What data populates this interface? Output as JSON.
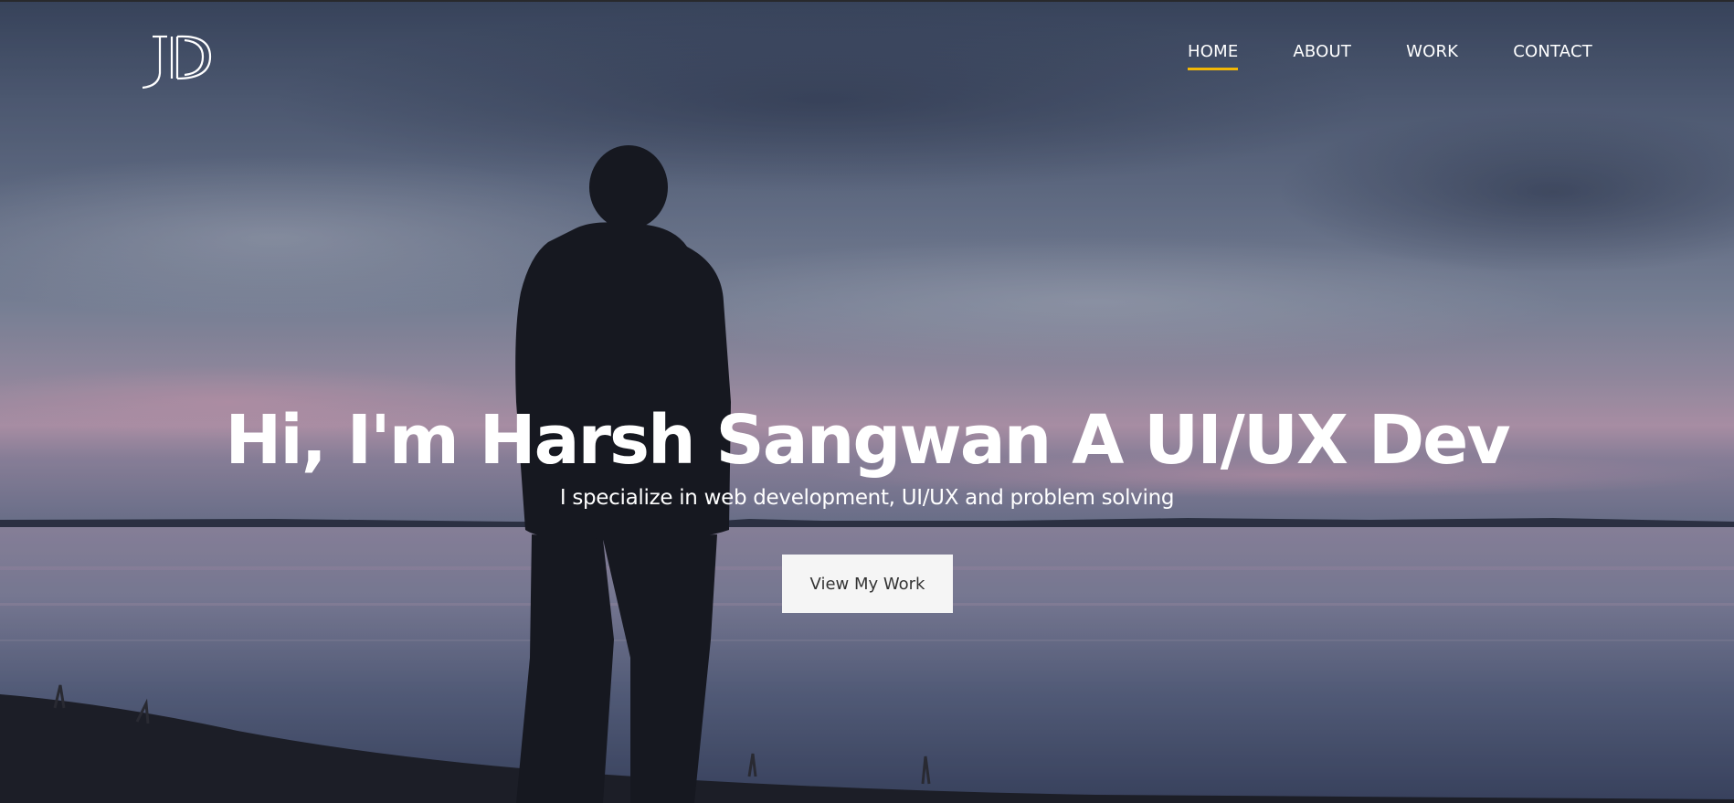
{
  "header": {
    "logo_text": "JD",
    "nav": [
      {
        "label": "HOME",
        "active": true
      },
      {
        "label": "ABOUT",
        "active": false
      },
      {
        "label": "WORK",
        "active": false
      },
      {
        "label": "CONTACT",
        "active": false
      }
    ]
  },
  "hero": {
    "headline": "Hi, I'm Harsh Sangwan A UI/UX Dev",
    "subtitle": "I specialize in web development, UI/UX and problem solving",
    "cta_label": "View My Work"
  },
  "colors": {
    "accent": "#f2b705",
    "text": "#ffffff",
    "button_bg": "#f5f5f5",
    "button_text": "#333333"
  }
}
